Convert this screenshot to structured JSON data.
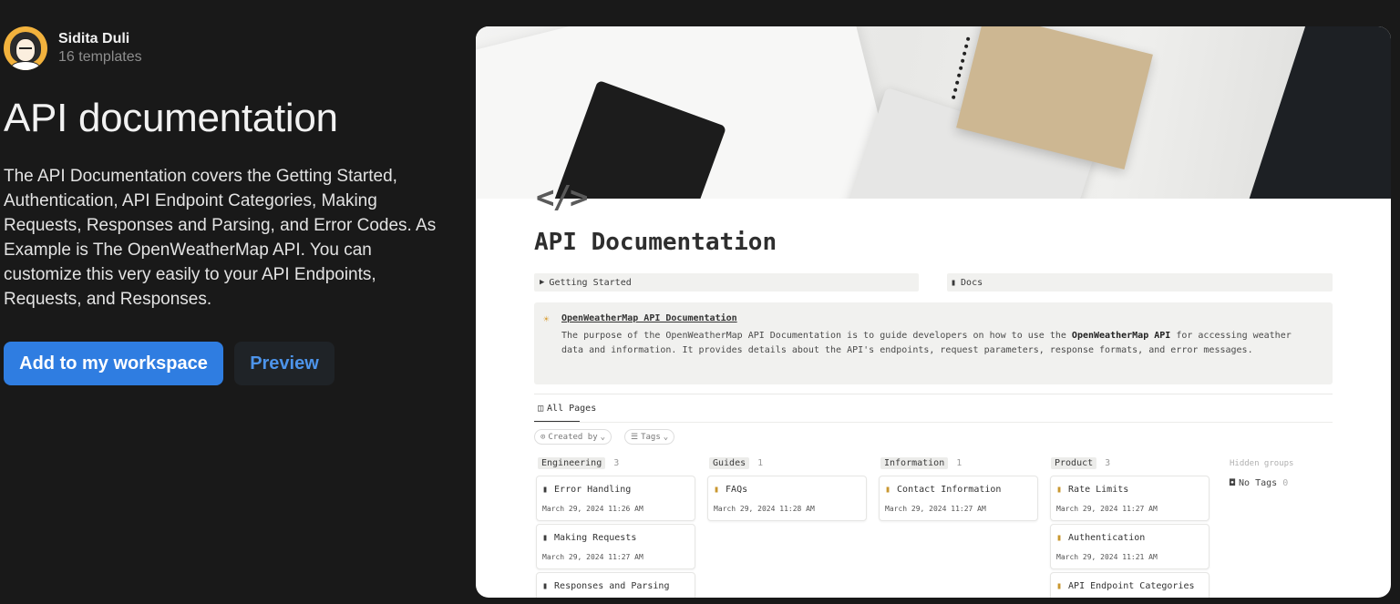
{
  "author": {
    "name": "Sidita Duli",
    "templates": "16 templates"
  },
  "template": {
    "title": "API documentation",
    "description": "The API Documentation covers the Getting Started, Authentication, API Endpoint Categories, Making Requests, Responses and Parsing, and Error Codes. As Example is The OpenWeatherMap API. You can customize this very easily to your API Endpoints, Requests, and Responses.",
    "add_button": "Add to my workspace",
    "preview_button": "Preview"
  },
  "preview": {
    "page_icon": "</>",
    "doc_title": "API Documentation",
    "toggle_getting_started": "Getting Started",
    "toggle_docs": "Docs",
    "callout": {
      "icon": "sun-cloud-icon",
      "title": "OpenWeatherMap API Documentation",
      "text_before": "The purpose of the OpenWeatherMap API Documentation is to guide developers on how to use the ",
      "text_bold": "OpenWeatherMap API",
      "text_after": " for accessing weather data and information. It provides details about the API's endpoints, request parameters, response formats, and error messages."
    },
    "view_tab": "All Pages",
    "filters": {
      "created_by": "Created by",
      "tags": "Tags"
    },
    "hidden_groups_label": "Hidden groups",
    "no_tags": {
      "label": "No Tags",
      "count": "0"
    },
    "groups": [
      {
        "name": "Engineering",
        "count": "3",
        "cards": [
          {
            "title": "Error Handling",
            "date": "March 29, 2024 11:26 AM"
          },
          {
            "title": "Making Requests",
            "date": "March 29, 2024 11:27 AM"
          },
          {
            "title": "Responses and Parsing",
            "date": ""
          }
        ]
      },
      {
        "name": "Guides",
        "count": "1",
        "cards": [
          {
            "title": "FAQs",
            "date": "March 29, 2024 11:28 AM"
          }
        ]
      },
      {
        "name": "Information",
        "count": "1",
        "cards": [
          {
            "title": "Contact Information",
            "date": "March 29, 2024 11:27 AM"
          }
        ]
      },
      {
        "name": "Product",
        "count": "3",
        "cards": [
          {
            "title": "Rate Limits",
            "date": "March 29, 2024 11:27 AM"
          },
          {
            "title": "Authentication",
            "date": "March 29, 2024 11:21 AM"
          },
          {
            "title": "API Endpoint Categories",
            "date": ""
          }
        ]
      }
    ]
  },
  "colors": {
    "background": "#191919",
    "primary_button": "#2f7de1",
    "preview_button_text": "#4d94ea"
  }
}
